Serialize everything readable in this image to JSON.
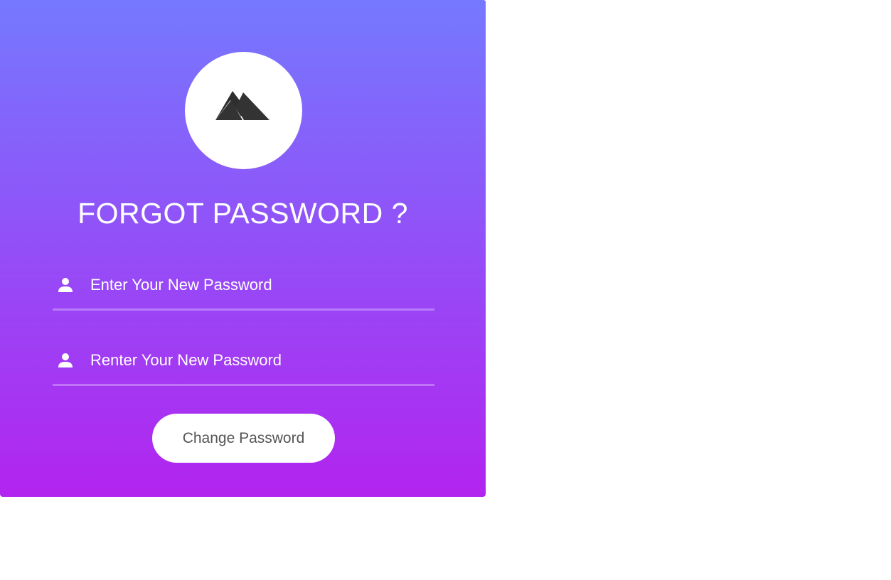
{
  "card": {
    "gradient_top": "#7579ff",
    "gradient_bottom": "#b224ef",
    "logo_icon": "mountain-icon",
    "title": "FORGOT PASSWORD ?"
  },
  "form": {
    "new_password": {
      "icon": "user-icon",
      "placeholder": "Enter Your New Password",
      "value": ""
    },
    "confirm_password": {
      "icon": "user-icon",
      "placeholder": "Renter Your New Password",
      "value": ""
    },
    "submit_label": "Change Password"
  }
}
